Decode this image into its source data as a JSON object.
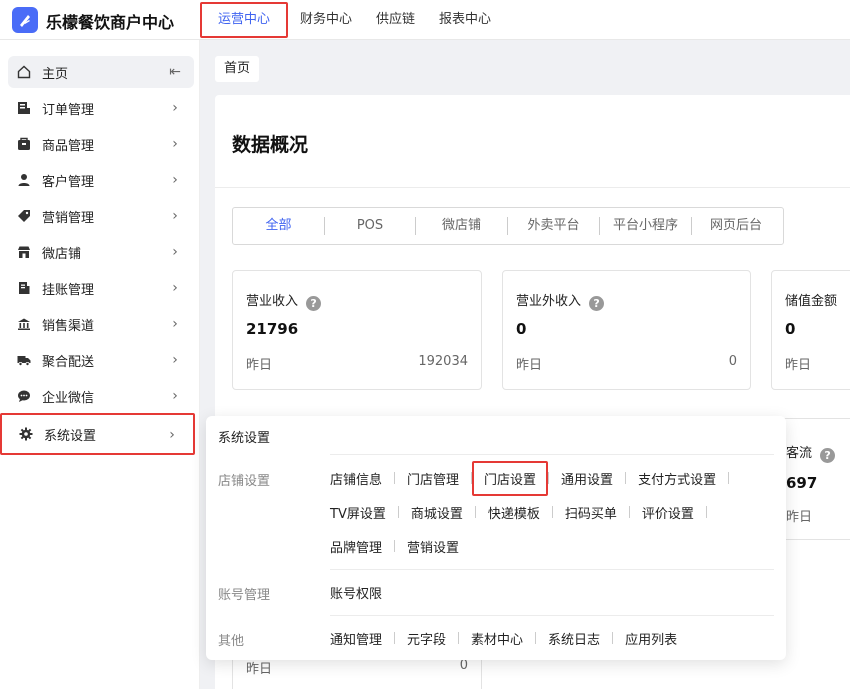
{
  "app": {
    "title": "乐檬餐饮商户中心"
  },
  "topnav": [
    {
      "label": "运营中心"
    },
    {
      "label": "财务中心"
    },
    {
      "label": "供应链"
    },
    {
      "label": "报表中心"
    }
  ],
  "sidebar": {
    "items": [
      {
        "label": "主页",
        "icon": "home-icon"
      },
      {
        "label": "订单管理",
        "icon": "order-icon"
      },
      {
        "label": "商品管理",
        "icon": "product-icon"
      },
      {
        "label": "客户管理",
        "icon": "user-icon"
      },
      {
        "label": "营销管理",
        "icon": "tag-icon"
      },
      {
        "label": "微店铺",
        "icon": "shop-icon"
      },
      {
        "label": "挂账管理",
        "icon": "ledger-icon"
      },
      {
        "label": "销售渠道",
        "icon": "bank-icon"
      },
      {
        "label": "聚合配送",
        "icon": "truck-icon"
      },
      {
        "label": "企业微信",
        "icon": "chat-icon"
      },
      {
        "label": "系统设置",
        "icon": "gear-icon"
      }
    ]
  },
  "breadcrumb": "首页",
  "main": {
    "title": "数据概况",
    "tabs": [
      "全部",
      "POS",
      "微店铺",
      "外卖平台",
      "平台小程序",
      "网页后台"
    ],
    "cards": [
      {
        "label": "营业收入",
        "value": "21796",
        "foot_label": "昨日",
        "foot_value": "192034"
      },
      {
        "label": "营业外收入",
        "value": "0",
        "foot_label": "昨日",
        "foot_value": "0"
      },
      {
        "label": "储值金额",
        "value": "0",
        "foot_label": "昨日",
        "foot_value": ""
      }
    ],
    "card_row2_partial": {
      "label_fragment": "客流",
      "value_fragment": "697",
      "foot_label": "昨日"
    },
    "card_bottom_partial": {
      "foot_label": "昨日",
      "foot_value": "0"
    }
  },
  "dropdown": {
    "title": "系统设置",
    "groups": [
      {
        "name": "店铺设置",
        "rows": [
          [
            "店铺信息",
            "门店管理",
            "门店设置",
            "通用设置",
            "支付方式设置"
          ],
          [
            "TV屏设置",
            "商城设置",
            "快递模板",
            "扫码买单",
            "评价设置"
          ],
          [
            "品牌管理",
            "营销设置"
          ]
        ]
      },
      {
        "name": "账号管理",
        "rows": [
          [
            "账号权限"
          ]
        ]
      },
      {
        "name": "其他",
        "rows": [
          [
            "通知管理",
            "元字段",
            "素材中心",
            "系统日志",
            "应用列表"
          ]
        ]
      }
    ]
  },
  "colors": {
    "accent": "#3f63f0",
    "highlight": "#e53935"
  }
}
